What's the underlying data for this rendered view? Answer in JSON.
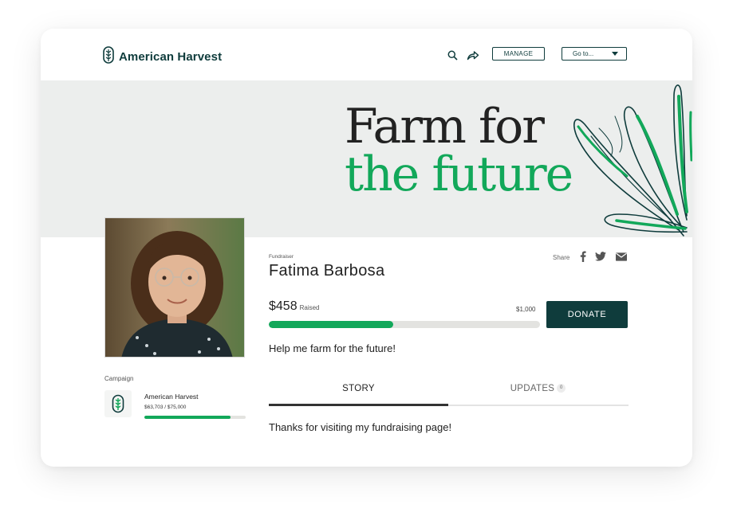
{
  "header": {
    "brand": "American Harvest",
    "manage_label": "MANAGE",
    "goto_label": "Go to...",
    "icons": [
      "search-icon",
      "share-arrow-icon",
      "chevron-down-icon"
    ]
  },
  "banner": {
    "title_line1": "Farm for",
    "title_line2": "the future"
  },
  "fundraiser": {
    "label": "Fundraiser",
    "name": "Fatima Barbosa",
    "share_label": "Share",
    "social_icons": [
      "facebook-icon",
      "twitter-icon",
      "email-icon"
    ],
    "raised": "$458",
    "raised_label": "Raised",
    "goal": "$1,000",
    "progress_fraction": 0.458,
    "donate_label": "DONATE",
    "tagline": "Help me farm for the future!"
  },
  "campaign": {
    "label": "Campaign",
    "name": "American Harvest",
    "amount": "$63,703 / $75,000",
    "progress_fraction": 0.849
  },
  "tabs": {
    "story_label": "STORY",
    "updates_label": "UPDATES",
    "updates_count": "0"
  },
  "story_text": "Thanks for visiting my fundraising page!",
  "colors": {
    "brand_dark": "#0f3c3c",
    "accent_green": "#12a85a",
    "banner_bg": "#eceeed"
  }
}
